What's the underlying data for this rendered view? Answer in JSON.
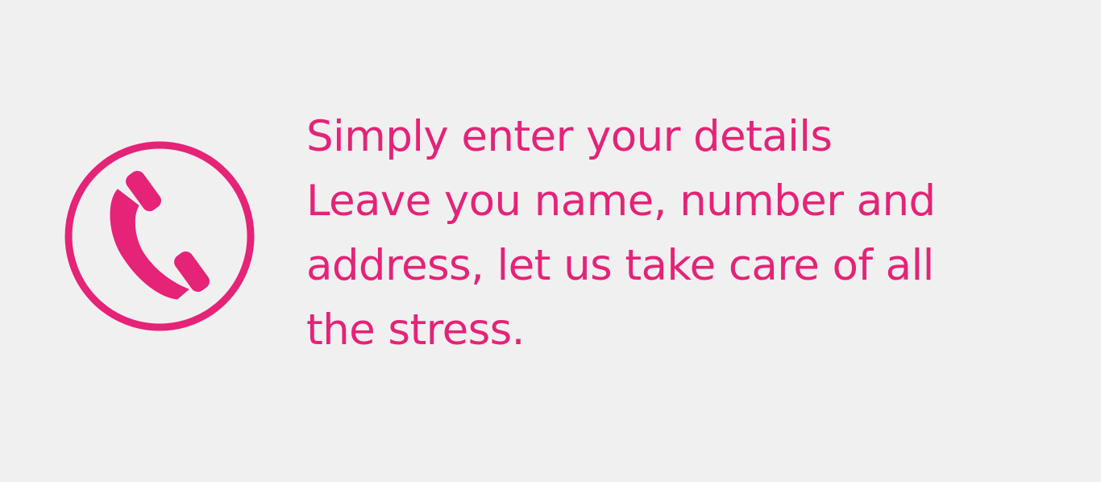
{
  "theme": {
    "accent": "#e52377",
    "background": "#f1f0f0"
  },
  "feature": {
    "icon": "phone-icon",
    "title": "Simply enter your details",
    "description": "Leave you name, number and address, let us take care of all the stress."
  }
}
